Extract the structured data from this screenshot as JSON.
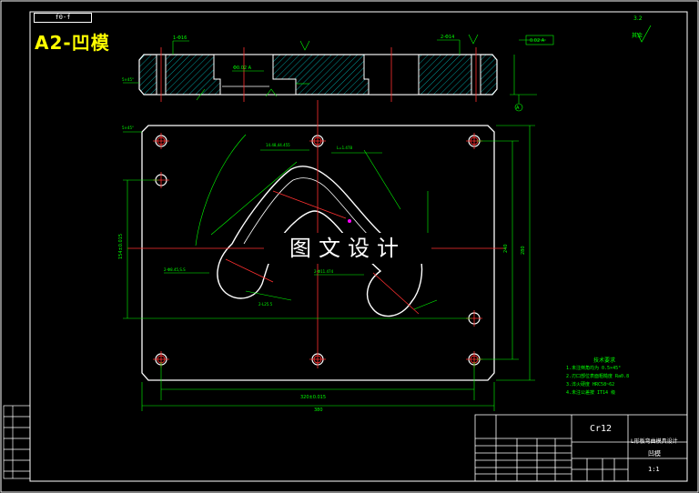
{
  "sheet": {
    "title": "A2-凹模",
    "code": "f0-f",
    "watermark": "图文设计"
  },
  "title_block": {
    "material": "Cr12",
    "drawing_name": "L形板弯曲模具设计",
    "part_name": "凹模",
    "scale": "1:1"
  },
  "notes": {
    "title": "技术要求",
    "lines": [
      "1.未注倒角均为 0.5×45°",
      "2.刃口部位表面粗糙度 Ra0.8",
      "3.淬火硬度 HRC58~62",
      "4.未注公差按 IT14 级"
    ]
  },
  "roughness_note": "其余"
}
